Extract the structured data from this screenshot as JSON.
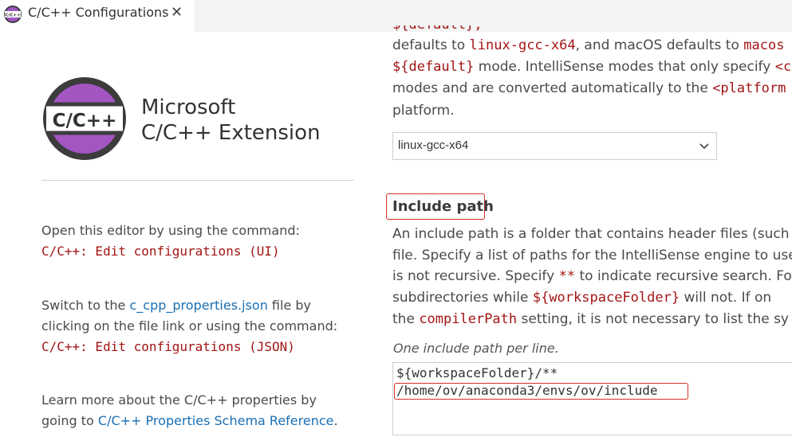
{
  "tab": {
    "title": "C/C++ Configurations",
    "close_glyph": "✕",
    "icon_text": "C/C++"
  },
  "brand": {
    "logo_text": "C/C++",
    "line1": "Microsoft",
    "line2": "C/C++ Extension",
    "logo_ring_color": "#3c3c3c",
    "logo_fill_color": "#a356c2"
  },
  "left": {
    "p1_text": "Open this editor by using the command:",
    "p1_command": "C/C++: Edit configurations (UI)",
    "p2_prefix": "Switch to the ",
    "p2_link": "c_cpp_properties.json",
    "p2_suffix": " file by",
    "p2_line2": "clicking on the file link or using the command:",
    "p2_command": "C/C++: Edit configurations (JSON)",
    "p3_line1": "Learn more about the C/C++ properties by",
    "p3_prefix": "going to ",
    "p3_link": "C/C++ Properties Schema Reference",
    "p3_suffix": "."
  },
  "intellisense": {
    "top_partial": "${default}, ",
    "l1_a": "defaults to ",
    "l1_code": "linux-gcc-x64",
    "l1_b": ", and macOS defaults to ",
    "l1_code2": "macos",
    "l2_code": "${default}",
    "l2_b": " mode. IntelliSense modes that only specify ",
    "l2_code2": "<c",
    "l3_a": "modes and are converted automatically to the ",
    "l3_code": "<platform",
    "l4": "platform.",
    "mode_selected": "linux-gcc-x64"
  },
  "include_path": {
    "title": "Include path",
    "d1": "An include path is a folder that contains header files (such",
    "d2": "file. Specify a list of paths for the IntelliSense engine to use",
    "d3_a": "is not recursive. Specify ",
    "d3_code": "**",
    "d3_b": " to indicate recursive search. For",
    "d4_a": "subdirectories while ",
    "d4_code": "${workspaceFolder}",
    "d4_b": " will not. If on",
    "d5_a": "the ",
    "d5_code": "compilerPath",
    "d5_b": " setting, it is not necessary to list the sy",
    "hint": "One include path per line.",
    "lines": [
      "${workspaceFolder}/**",
      "/home/ov/anaconda3/envs/ov/include"
    ]
  },
  "colors": {
    "code_red": "#a31515",
    "link_blue": "#1a6fb5",
    "highlight_red": "#d93025"
  }
}
